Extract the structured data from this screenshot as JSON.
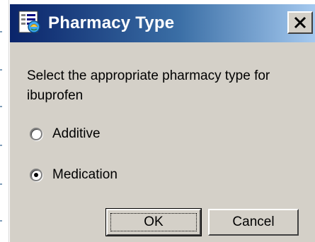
{
  "window": {
    "title": "Pharmacy Type",
    "icon": "pharmacy-form-icon",
    "close_icon": "close-icon"
  },
  "dialog": {
    "prompt": "Select the appropriate pharmacy type for ibuprofen",
    "options": [
      {
        "label": "Additive",
        "selected": false
      },
      {
        "label": "Medication",
        "selected": true
      }
    ],
    "ok_label": "OK",
    "cancel_label": "Cancel"
  },
  "colors": {
    "title_gradient_start": "#0a246a",
    "title_gradient_end": "#a6caf0",
    "face": "#d4d0c8"
  }
}
